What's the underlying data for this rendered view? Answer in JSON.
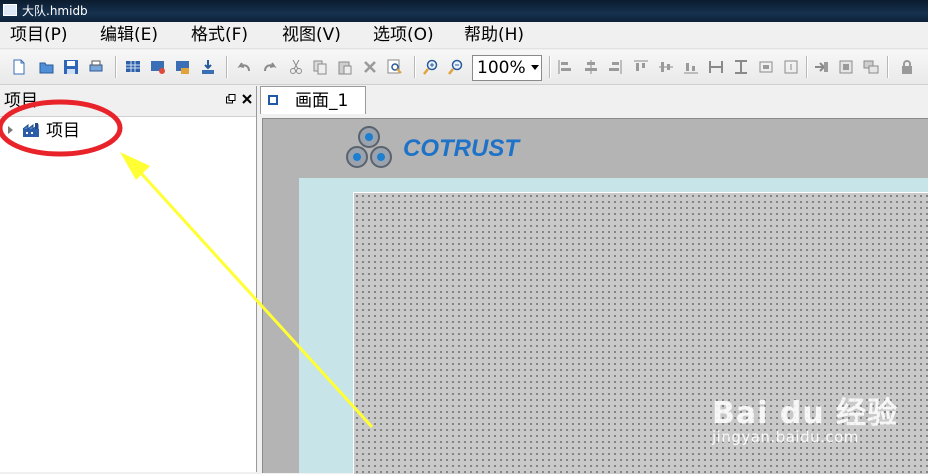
{
  "window": {
    "title": "大队.hmidb"
  },
  "menu": [
    {
      "label": "项目(P)"
    },
    {
      "label": "编辑(E)"
    },
    {
      "label": "格式(F)"
    },
    {
      "label": "视图(V)"
    },
    {
      "label": "选项(O)"
    },
    {
      "label": "帮助(H)"
    }
  ],
  "toolbar": {
    "zoom_value": "100%",
    "icons": [
      "new-icon",
      "open-icon",
      "save-icon",
      "print-icon",
      "screen-grid-icon",
      "screen-settings-icon",
      "screen-export-icon",
      "download-icon",
      "undo-icon",
      "redo-icon",
      "cut-icon",
      "copy-icon",
      "paste-icon",
      "delete-icon",
      "find-icon",
      "zoom-in-icon",
      "zoom-out-icon",
      "align-left-icon",
      "align-center-v-icon",
      "align-right-icon",
      "align-top-icon",
      "align-middle-icon",
      "align-bottom-icon",
      "same-width-icon",
      "same-height-icon",
      "same-size-icon",
      "center-icon",
      "bring-front-icon",
      "send-back-icon",
      "group-icon",
      "lock-icon"
    ]
  },
  "left_panel": {
    "title": "项目",
    "tree": [
      {
        "label": "项目"
      }
    ]
  },
  "tabs": [
    {
      "label": "画面_1"
    }
  ],
  "canvas": {
    "logo_text": "COTRUST",
    "border_color": "#c7e4e8",
    "surface_color": "#c9c9c9"
  },
  "annotation": {
    "circle_color": "#e8232a",
    "arrow_color": "#ffff33"
  },
  "watermark": {
    "brand": "Bai du 经验",
    "url": "jingyan.baidu.com"
  }
}
